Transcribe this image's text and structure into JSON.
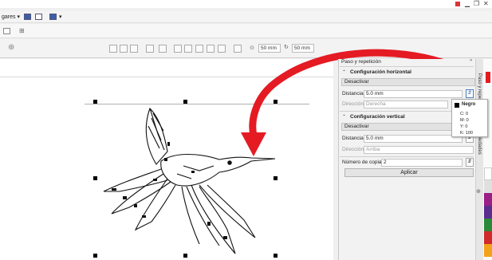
{
  "toolbar": {
    "row1_label": "gares ▾",
    "row1_dropdown": "▾",
    "size_w": "50 mm",
    "size_h": "50 mm"
  },
  "docker": {
    "title": "Paso y repetición",
    "horizontal": {
      "header": "Configuración horizontal",
      "mode": "Desactivar",
      "distance_label": "Distancia:",
      "distance_value": "5.0 mm",
      "direction_label": "Dirección:",
      "direction_value": "Derecha"
    },
    "vertical": {
      "header": "Configuración vertical",
      "mode": "Desactivar",
      "distance_label": "Distancia:",
      "distance_value": "5.0 mm",
      "direction_label": "Dirección:",
      "direction_value": "Arriba"
    },
    "copies_label": "Número de copias:",
    "copies_value": "2",
    "apply": "Aplicar"
  },
  "tooltip": {
    "name": "Negro",
    "c": "C: 0",
    "m": "M: 0",
    "y": "Y: 0",
    "k": "K: 100"
  },
  "side_tabs": {
    "tab1": "Paso y repetición",
    "tab2": "Propiedades"
  },
  "colors": {
    "arrow": "#e41b23",
    "palette": [
      "#ffffff",
      "#e0e0e0",
      "#9a1f86",
      "#5a2d8f",
      "#2a8a3a",
      "#d12a2a",
      "#f3a21b",
      "#ffe600"
    ]
  }
}
